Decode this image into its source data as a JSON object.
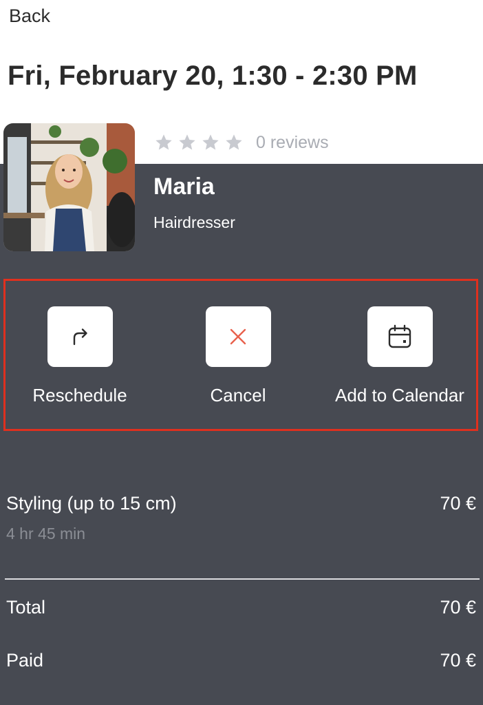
{
  "nav": {
    "back_label": "Back"
  },
  "appointment": {
    "title": "Fri, February 20, 1:30 - 2:30 PM"
  },
  "specialist": {
    "name": "Maria",
    "role": "Hairdresser",
    "rating_stars": 0,
    "reviews_label": "0 reviews"
  },
  "actions": [
    {
      "label": "Reschedule",
      "icon": "reschedule-arrow-icon"
    },
    {
      "label": "Cancel",
      "icon": "close-icon"
    },
    {
      "label": "Add to Calendar",
      "icon": "calendar-icon"
    }
  ],
  "service": {
    "name": "Styling (up to 15 cm)",
    "duration": "4 hr 45 min",
    "price": "70 €"
  },
  "summary": {
    "total_label": "Total",
    "total_value": "70 €",
    "paid_label": "Paid",
    "paid_value": "70 €"
  },
  "colors": {
    "dark_panel": "#474a52",
    "highlight_border": "#e0301e",
    "cancel_icon": "#e8604c",
    "star_empty": "#c8cad0"
  }
}
